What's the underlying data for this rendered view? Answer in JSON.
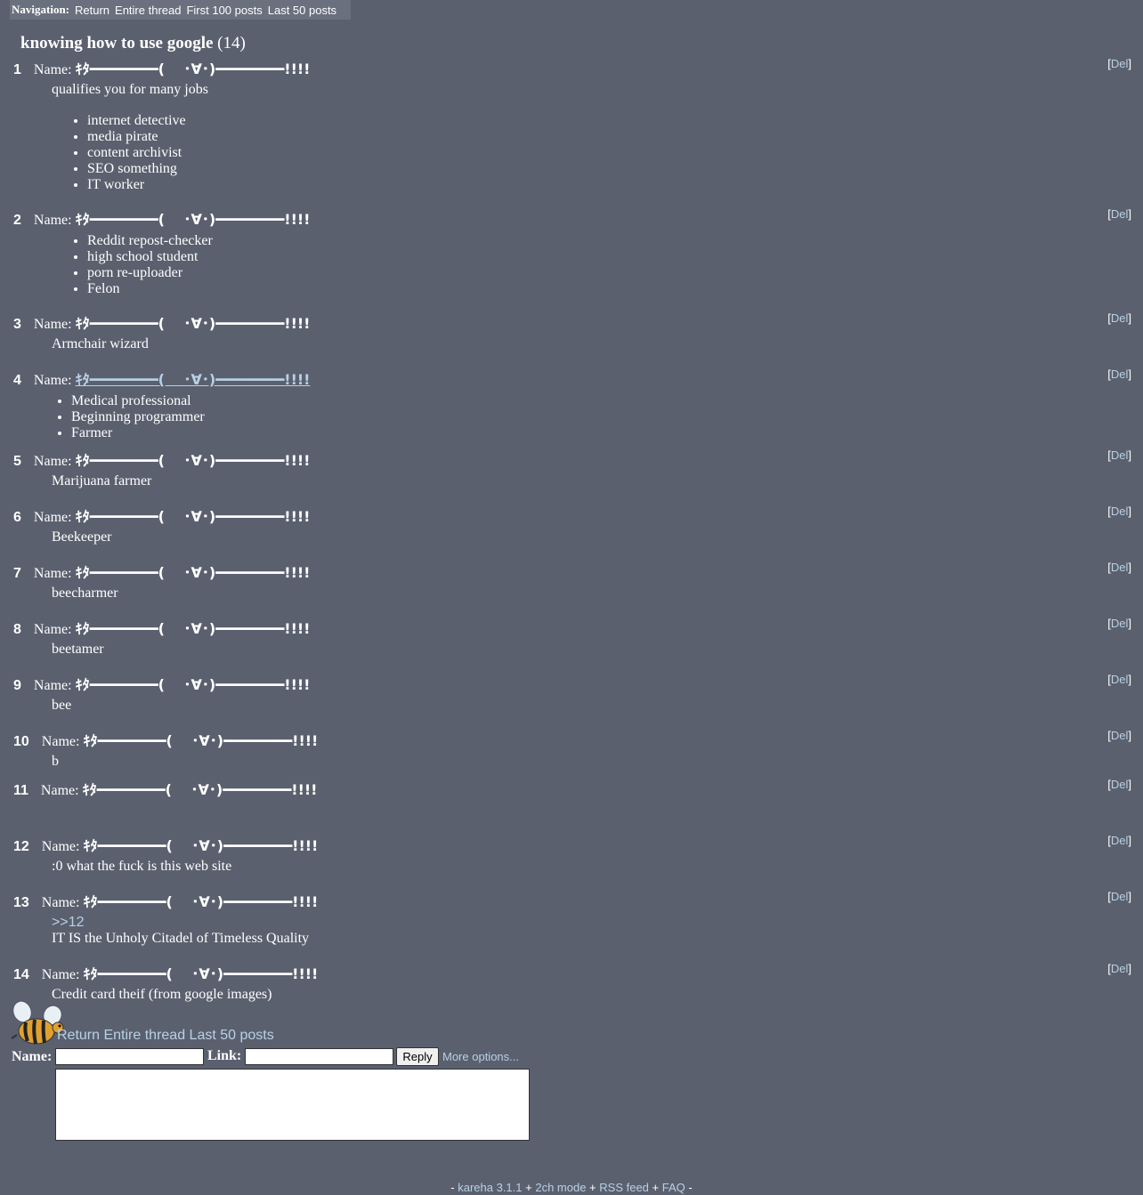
{
  "nav": {
    "label": "Navigation:",
    "links": [
      "Return",
      "Entire thread",
      "First 100 posts",
      "Last 50 posts"
    ]
  },
  "thread": {
    "title": "knowing how to use google",
    "count": "(14)"
  },
  "name_label": "Name:",
  "trip": "ｷﾀ━━━━━━━━(　 ･∀･)━━━━━━━━!!!!",
  "del_label": "Del",
  "posts": [
    {
      "num": "1",
      "lines": [
        "qualifies you for many jobs"
      ],
      "list": [
        "internet detective",
        "media pirate",
        "content archivist",
        "SEO something",
        "IT worker"
      ]
    },
    {
      "num": "2",
      "list": [
        "Reddit repost-checker",
        "high school student",
        "porn re-uploader",
        "Felon"
      ]
    },
    {
      "num": "3",
      "lines": [
        "Armchair wizard"
      ]
    },
    {
      "num": "4",
      "list": [
        "Medical professional",
        "Beginning programmer",
        "Farmer"
      ]
    },
    {
      "num": "5",
      "lines": [
        "Marijuana farmer"
      ]
    },
    {
      "num": "6",
      "lines": [
        "Beekeeper"
      ]
    },
    {
      "num": "7",
      "lines": [
        "beecharmer"
      ]
    },
    {
      "num": "8",
      "lines": [
        "beetamer"
      ]
    },
    {
      "num": "9",
      "lines": [
        "bee"
      ]
    },
    {
      "num": "10",
      "lines": [
        "b"
      ]
    },
    {
      "num": "11",
      "lines": []
    },
    {
      "num": "12",
      "lines": [
        ":0 what the fuck is this web site"
      ]
    },
    {
      "num": "13",
      "quote": ">>12",
      "lines": [
        "IT IS the Unholy Citadel of Timeless Quality"
      ]
    },
    {
      "num": "14",
      "lines": [
        "Credit card theif (from google images)"
      ]
    }
  ],
  "bottom_links": [
    "Return",
    "Entire thread",
    "Last 50 posts"
  ],
  "form": {
    "name_label": "Name:",
    "link_label": "Link:",
    "reply_label": "Reply",
    "more_options": "More options..."
  },
  "footer": {
    "links": [
      "kareha 3.1.1",
      "2ch mode",
      "RSS feed",
      "FAQ"
    ]
  }
}
